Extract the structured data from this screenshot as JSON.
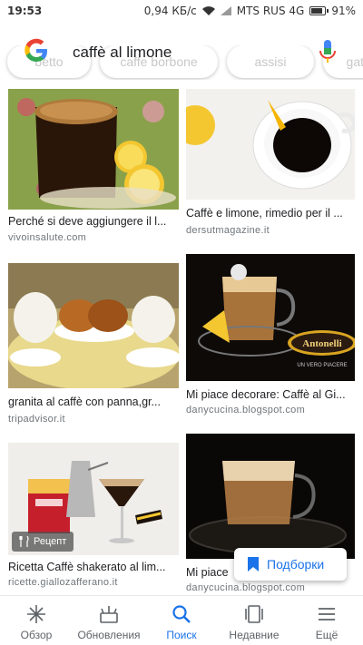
{
  "status_bar": {
    "time": "19:53",
    "speed": "0,94 КБ/с",
    "carrier": "MTS RUS 4G",
    "battery": "91%",
    "battery_level": 0.91
  },
  "search": {
    "query": "caffè al limone",
    "chips": [
      "betto",
      "caffe borbone",
      "assisi",
      "gattop"
    ]
  },
  "results": [
    {
      "caption": "Perché si deve aggiungere il l...",
      "source": "vivoinsalute.com"
    },
    {
      "caption": "Caffè e limone, rimedio per il ...",
      "source": "dersutmagazine.it"
    },
    {
      "caption": "granita al caffè con panna,gr...",
      "source": "tripadvisor.it"
    },
    {
      "caption": "Mi piace decorare: Caffè al Gi...",
      "source": "danycucina.blogspot.com",
      "img_text_1": "Antonelli",
      "img_text_2": "UN VERO PIACERE"
    },
    {
      "caption": "Ricetta Caffè shakerato al lim...",
      "source": "ricette.giallozafferano.it",
      "badge": "Рецепт"
    },
    {
      "caption": "Mi piace",
      "source": "danycucina.blogspot.com"
    }
  ],
  "fab": {
    "label": "Подборки"
  },
  "nav": [
    {
      "label": "Обзор",
      "icon": "asterisk-icon"
    },
    {
      "label": "Обновления",
      "icon": "updates-icon"
    },
    {
      "label": "Поиск",
      "icon": "search-icon"
    },
    {
      "label": "Недавние",
      "icon": "recent-icon"
    },
    {
      "label": "Ещё",
      "icon": "menu-icon"
    }
  ],
  "colors": {
    "accent": "#1a73e8"
  }
}
